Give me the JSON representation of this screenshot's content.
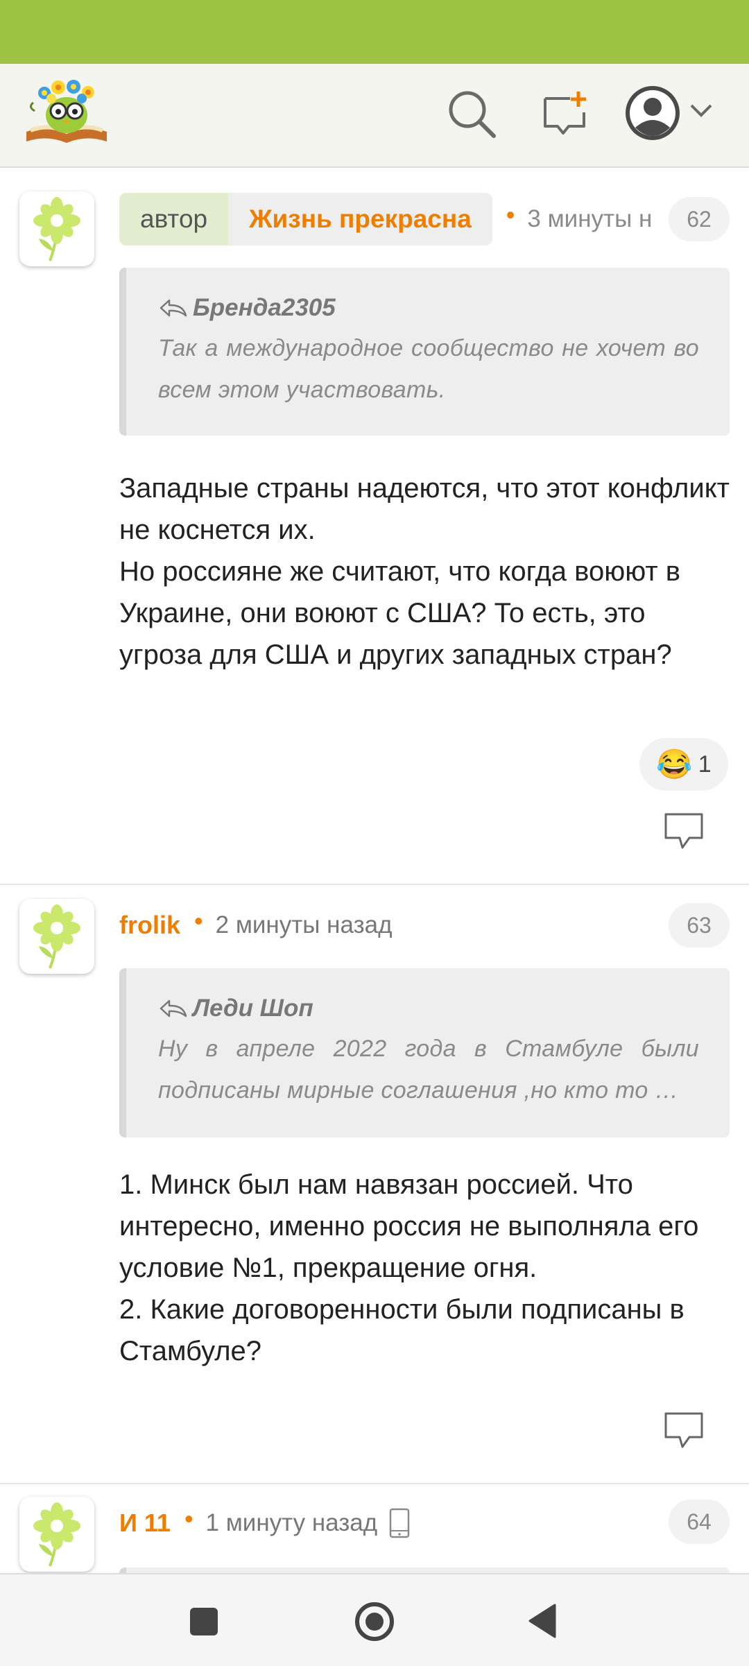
{
  "colors": {
    "status_bar": "#9dc244",
    "accent": "#ef7d00",
    "author_tag_bg": "#e3edcf",
    "quote_bg": "#eeeeee"
  },
  "header": {
    "logo_icon": "owl-with-flowers-on-book-logo",
    "search_icon": "search-icon",
    "new_post_icon": "new-post-icon",
    "profile_icon": "user-avatar-icon",
    "menu_icon": "chevron-down-icon"
  },
  "comments": [
    {
      "number": "62",
      "author_tag": "автор",
      "author": "Жизнь прекрасна",
      "time": "3 минуты н",
      "quote": {
        "author": "Бренда2305",
        "text": "Так а международное сообщество не хочет во всем этом участвовать."
      },
      "lines": [
        "Западные страны надеются, что этот конфликт не коснется их.",
        "Но россияне же считают, что когда воюют в Украине, они воюют с США? То есть, это угроза для США и других западных стран?"
      ],
      "reaction": {
        "emoji": "😂",
        "count": "1"
      }
    },
    {
      "number": "63",
      "author": "frolik",
      "time": "2 минуты назад",
      "quote": {
        "author": "Леди Шоп",
        "text": "Ну в апреле 2022 года в Стамбуле были подписаны мирные соглашения ,но кто то …"
      },
      "lines": [
        "1. Минск был нам навязан россией. Что интересно, именно россия не выполняла его условие №1, прекращение огня.",
        "2. Какие договоренности были подписаны в Стамбуле?"
      ]
    },
    {
      "number": "64",
      "author": "И 11",
      "time": "1 минуту назад",
      "device_icon": "mobile-phone-icon"
    }
  ],
  "navbar": {
    "recents_icon": "square-recents-icon",
    "home_icon": "circle-home-icon",
    "back_icon": "triangle-back-icon"
  }
}
